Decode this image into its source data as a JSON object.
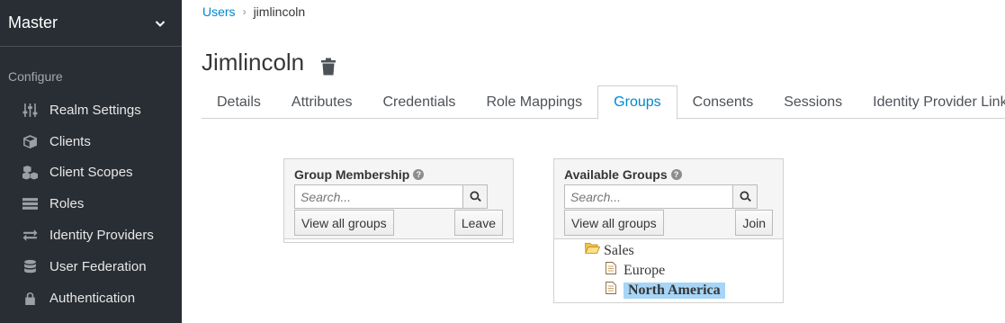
{
  "sidebar": {
    "realm": "Master",
    "section": "Configure",
    "items": [
      {
        "label": "Realm Settings",
        "icon": "sliders-icon"
      },
      {
        "label": "Clients",
        "icon": "cube-icon"
      },
      {
        "label": "Client Scopes",
        "icon": "cubes-icon"
      },
      {
        "label": "Roles",
        "icon": "list-icon"
      },
      {
        "label": "Identity Providers",
        "icon": "exchange-icon"
      },
      {
        "label": "User Federation",
        "icon": "database-icon"
      },
      {
        "label": "Authentication",
        "icon": "lock-icon"
      }
    ]
  },
  "breadcrumb": {
    "parent": "Users",
    "current": "jimlincoln"
  },
  "title": "Jimlincoln",
  "tabs": [
    "Details",
    "Attributes",
    "Credentials",
    "Role Mappings",
    "Groups",
    "Consents",
    "Sessions",
    "Identity Provider Links"
  ],
  "active_tab": "Groups",
  "membership": {
    "title": "Group Membership",
    "search_placeholder": "Search...",
    "view_all": "View all groups",
    "action": "Leave"
  },
  "available": {
    "title": "Available Groups",
    "search_placeholder": "Search...",
    "view_all": "View all groups",
    "action": "Join",
    "tree": {
      "root": "Sales",
      "children": [
        "Europe",
        "North America"
      ],
      "selected": "North America"
    }
  },
  "colors": {
    "sidebar_bg": "#292e34",
    "link": "#0088ce",
    "selection": "#a6d5f7"
  }
}
